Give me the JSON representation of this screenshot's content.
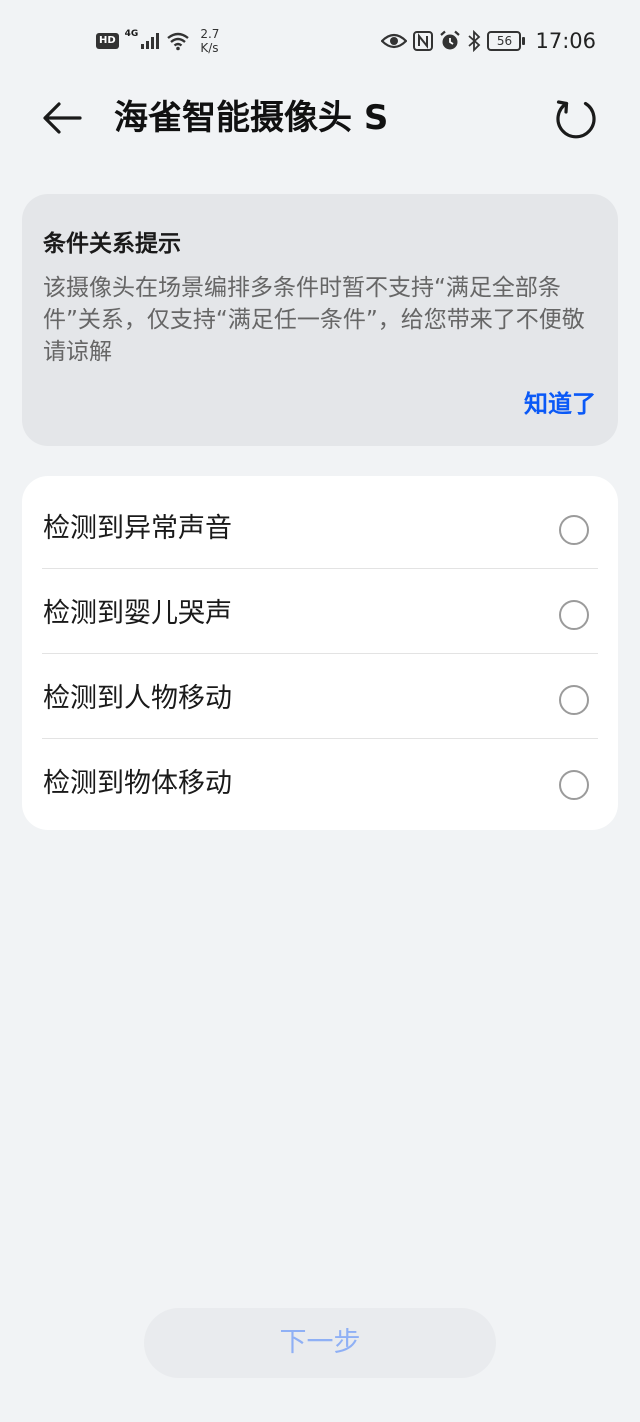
{
  "status_bar": {
    "hd": "HD",
    "network": "4G",
    "speed_value": "2.7",
    "speed_unit": "K/s",
    "battery": "56",
    "time": "17:06"
  },
  "header": {
    "title": "海雀智能摄像头 S"
  },
  "tip": {
    "title": "条件关系提示",
    "body": "该摄像头在场景编排多条件时暂不支持“满足全部条件”关系，仅支持“满足任一条件”，给您带来了不便敬请谅解",
    "ok_label": "知道了",
    "accent_color": "#0a59f7"
  },
  "options": [
    {
      "label": "检测到异常声音",
      "selected": false
    },
    {
      "label": "检测到婴儿哭声",
      "selected": false
    },
    {
      "label": "检测到人物移动",
      "selected": false
    },
    {
      "label": "检测到物体移动",
      "selected": false
    }
  ],
  "footer": {
    "next_label": "下一步"
  }
}
